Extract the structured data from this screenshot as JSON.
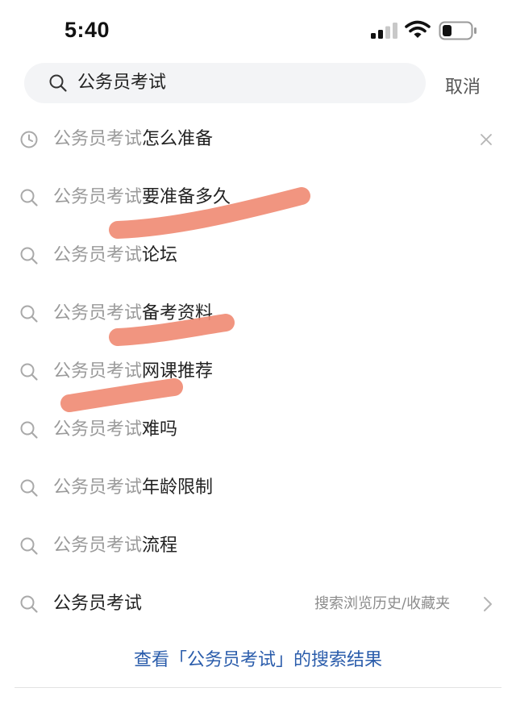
{
  "status_bar": {
    "time": "5:40",
    "icons": [
      "signal-icon",
      "wifi-icon",
      "battery-icon"
    ]
  },
  "search": {
    "query": "公务员考试",
    "cancel_label": "取消"
  },
  "suggestions": [
    {
      "icon": "clock-icon",
      "prefix": "公务员考试",
      "suffix": "怎么准备",
      "deletable": true
    },
    {
      "icon": "search-icon",
      "prefix": "公务员考试",
      "suffix": "要准备多久"
    },
    {
      "icon": "search-icon",
      "prefix": "公务员考试",
      "suffix": "论坛"
    },
    {
      "icon": "search-icon",
      "prefix": "公务员考试",
      "suffix": "备考资料"
    },
    {
      "icon": "search-icon",
      "prefix": "公务员考试",
      "suffix": "网课推荐"
    },
    {
      "icon": "search-icon",
      "prefix": "公务员考试",
      "suffix": "难吗"
    },
    {
      "icon": "search-icon",
      "prefix": "公务员考试",
      "suffix": "年龄限制"
    },
    {
      "icon": "search-icon",
      "prefix": "公务员考试",
      "suffix": "流程"
    }
  ],
  "history_row": {
    "icon": "search-icon",
    "text": "公务员考试",
    "link_label": "搜索浏览历史/收藏夹"
  },
  "view_results_label": "查看「公务员考试」的搜索结果",
  "colors": {
    "link_blue": "#2a5cab",
    "highlight": "#f08a72",
    "search_bg": "#f3f4f6"
  }
}
